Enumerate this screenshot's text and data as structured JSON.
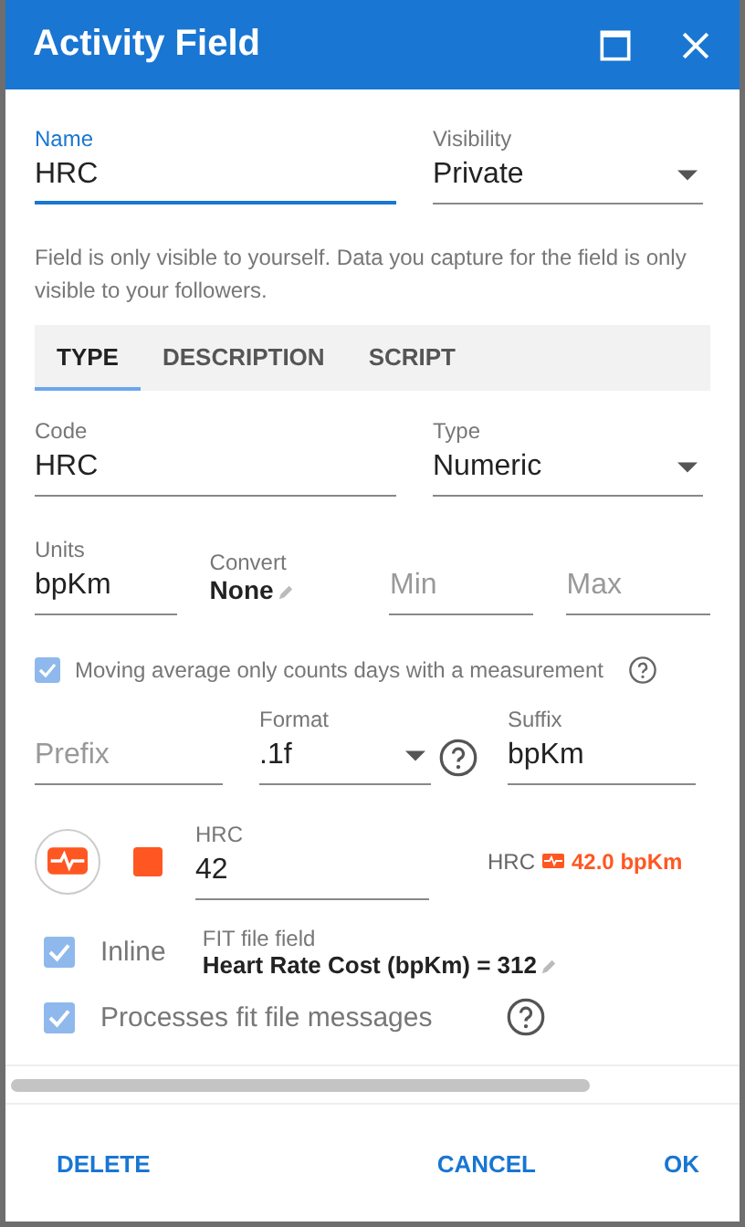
{
  "window": {
    "title": "Activity Field"
  },
  "name_field": {
    "label": "Name",
    "value": "HRC",
    "focused": true
  },
  "visibility": {
    "label": "Visibility",
    "value": "Private"
  },
  "visibility_note": "Field is only visible to yourself. Data you capture for the field is only visible to your followers.",
  "tabs": [
    {
      "label": "TYPE",
      "selected": true
    },
    {
      "label": "DESCRIPTION",
      "selected": false
    },
    {
      "label": "SCRIPT",
      "selected": false
    }
  ],
  "code": {
    "label": "Code",
    "value": "HRC"
  },
  "type": {
    "label": "Type",
    "value": "Numeric"
  },
  "units": {
    "label": "Units",
    "value": "bpKm"
  },
  "convert": {
    "label": "Convert",
    "value": "None"
  },
  "min": {
    "placeholder": "Min"
  },
  "max": {
    "placeholder": "Max"
  },
  "moving_average": {
    "label": "Moving average only counts days with a measurement",
    "checked": true,
    "disabled": true
  },
  "prefix": {
    "placeholder": "Prefix"
  },
  "format": {
    "label": "Format",
    "value": ".1f"
  },
  "suffix": {
    "label": "Suffix",
    "value": "bpKm"
  },
  "preview": {
    "color": "#ff5722",
    "field": {
      "label": "HRC",
      "value": "42"
    },
    "sample_label": "HRC",
    "sample_value": "42.0 bpKm"
  },
  "inline": {
    "label": "Inline",
    "checked": true,
    "disabled": true
  },
  "fit_field": {
    "label": "FIT file field",
    "value": "Heart Rate Cost (bpKm) = 312"
  },
  "processes_fit": {
    "label": "Processes fit file messages",
    "checked": true,
    "disabled": true
  },
  "buttons": [
    {
      "label": "DELETE"
    },
    {
      "label": "CANCEL"
    },
    {
      "label": "OK"
    }
  ]
}
